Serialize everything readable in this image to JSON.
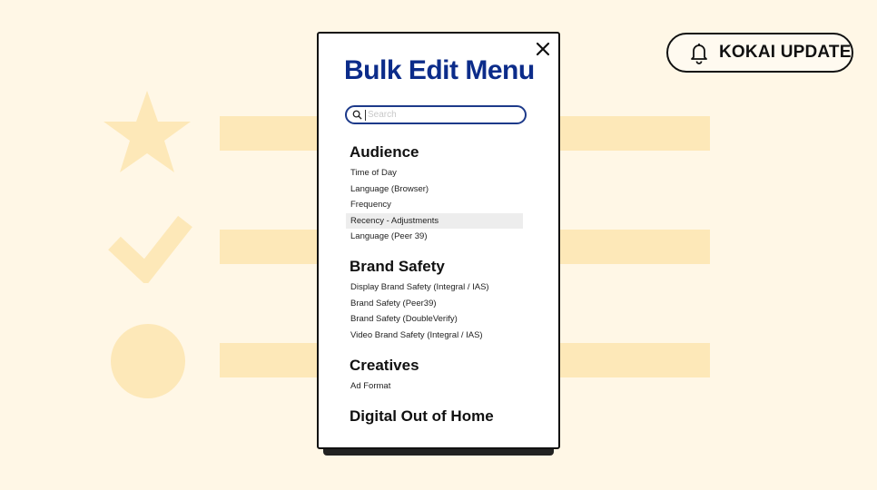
{
  "badge": {
    "label": "KOKAI UPDATE",
    "icon": "bell-icon"
  },
  "modal": {
    "title": "Bulk Edit Menu",
    "search": {
      "value": "",
      "placeholder": "Search"
    },
    "sections": [
      {
        "heading": "Audience",
        "items": [
          "Time of Day",
          "Language (Browser)",
          "Frequency",
          "Recency - Adjustments",
          "Language (Peer 39)"
        ],
        "highlighted_index": 3
      },
      {
        "heading": "Brand Safety",
        "items": [
          "Display Brand Safety (Integral / IAS)",
          "Brand Safety (Peer39)",
          "Brand Safety (DoubleVerify)",
          "Video Brand Safety (Integral / IAS)"
        ]
      },
      {
        "heading": "Creatives",
        "items": [
          "Ad Format"
        ]
      },
      {
        "heading": "Digital Out of Home",
        "items": []
      }
    ]
  },
  "background": {
    "icons": [
      "star-icon",
      "check-icon",
      "circle-icon"
    ]
  },
  "colors": {
    "page_bg": "#fff7e6",
    "bar": "#fde8b8",
    "title": "#0c2c8a",
    "search_border": "#1d3a8a",
    "highlight": "#ededed"
  }
}
